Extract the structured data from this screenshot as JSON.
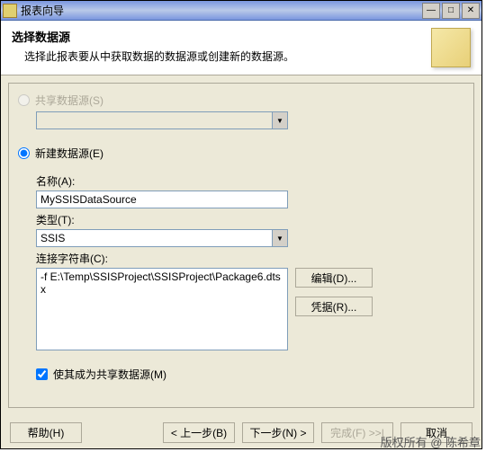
{
  "window": {
    "title": "报表向导"
  },
  "header": {
    "title": "选择数据源",
    "subtitle": "选择此报表要从中获取数据的数据源或创建新的数据源。"
  },
  "options": {
    "shared_label": "共享数据源(S)",
    "new_label": "新建数据源(E)"
  },
  "form": {
    "name_label": "名称(A):",
    "name_value": "MySSISDataSource",
    "type_label": "类型(T):",
    "type_value": "SSIS",
    "conn_label": "连接字符串(C):",
    "conn_value": "-f E:\\Temp\\SSISProject\\SSISProject\\Package6.dtsx"
  },
  "sidebuttons": {
    "edit": "编辑(D)...",
    "cred": "凭据(R)..."
  },
  "checkbox": {
    "make_shared": "使其成为共享数据源(M)"
  },
  "buttons": {
    "help": "帮助(H)",
    "back": "< 上一步(B)",
    "next": "下一步(N) >",
    "finish": "完成(F) >>|",
    "cancel": "取消"
  },
  "copyright": "版权所有 @ 陈希章"
}
